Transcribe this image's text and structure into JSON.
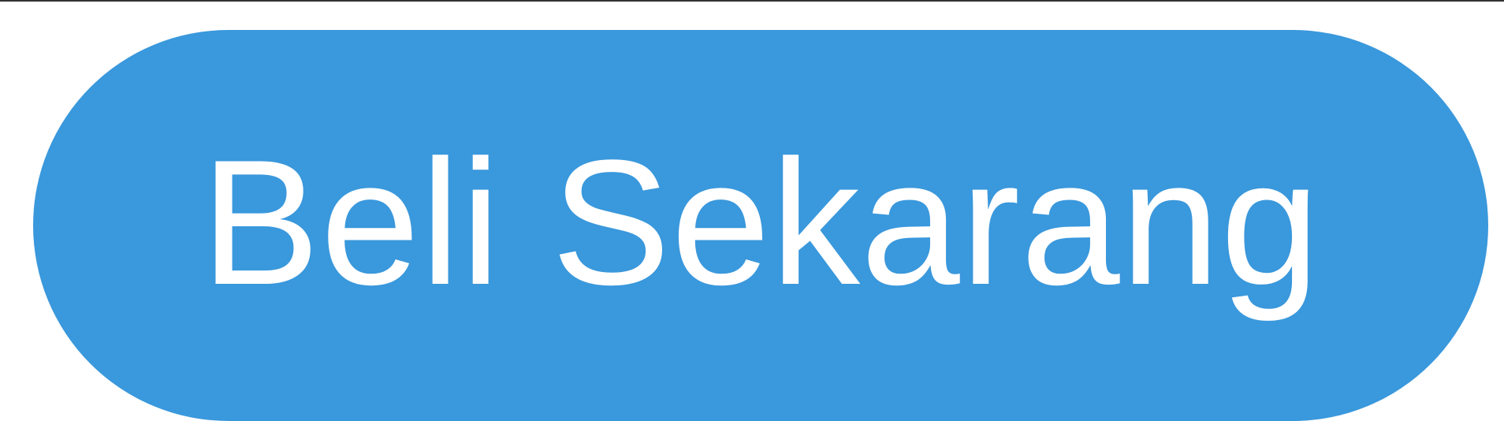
{
  "button": {
    "label": "Beli Sekarang",
    "background_color": "#3a98dc",
    "text_color": "#ffffff"
  }
}
